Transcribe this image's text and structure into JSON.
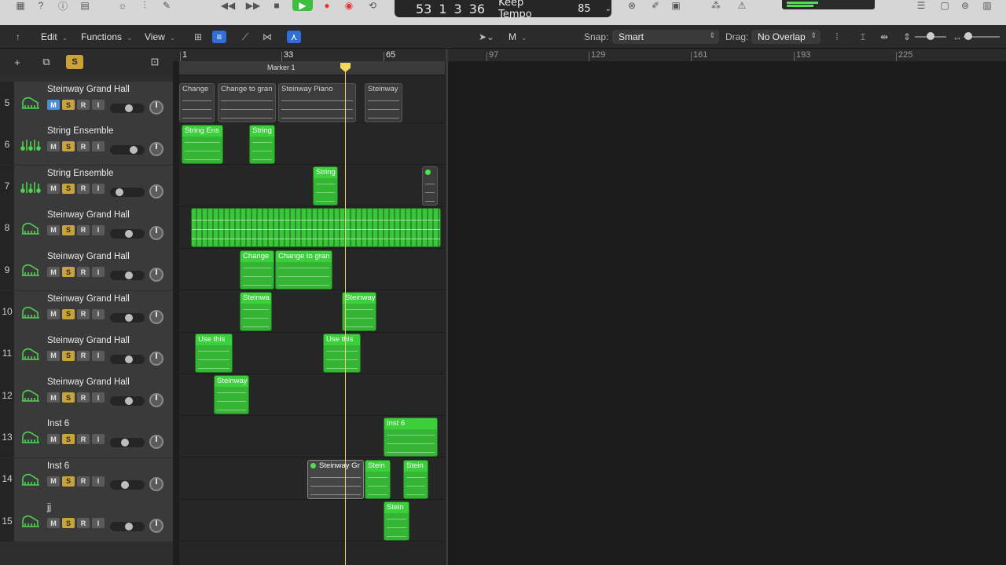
{
  "lcd": {
    "bar": "53",
    "beat": "1",
    "div": "3",
    "tick": "36",
    "tempo_mode": "Keep Tempo",
    "tempo": "85"
  },
  "toolbar": {
    "edit": "Edit",
    "functions": "Functions",
    "view": "View",
    "pointer_tool": "M",
    "snap_label": "Snap:",
    "snap_value": "Smart",
    "drag_label": "Drag:",
    "drag_value": "No Overlap"
  },
  "header": {
    "solo_label": "S"
  },
  "ruler": {
    "bars": [
      {
        "label": "1",
        "dim": false
      },
      {
        "label": "33",
        "dim": false
      },
      {
        "label": "65",
        "dim": false
      },
      {
        "label": "97",
        "dim": true
      },
      {
        "label": "129",
        "dim": true
      },
      {
        "label": "161",
        "dim": true
      },
      {
        "label": "193",
        "dim": true
      },
      {
        "label": "225",
        "dim": true
      }
    ],
    "marker": "Marker 1"
  },
  "colors": {
    "region_green": "#34b534",
    "solo": "#c9a23c",
    "mute_on": "#4a8fd4",
    "playhead": "#f0d95c"
  },
  "tracks": [
    {
      "num": "5",
      "name": "Steinway Grand Hall",
      "icon": "piano-icon",
      "mute_on": true,
      "vol": 0.55
    },
    {
      "num": "6",
      "name": "String Ensemble",
      "icon": "strings-icon",
      "mute_on": false,
      "vol": 0.75
    },
    {
      "num": "7",
      "name": "String Ensemble",
      "icon": "strings-icon",
      "mute_on": false,
      "vol": 0.2
    },
    {
      "num": "8",
      "name": "Steinway Grand Hall",
      "icon": "piano-icon",
      "mute_on": false,
      "vol": 0.55
    },
    {
      "num": "9",
      "name": "Steinway Grand Hall",
      "icon": "piano-icon",
      "mute_on": false,
      "vol": 0.55
    },
    {
      "num": "10",
      "name": "Steinway Grand Hall",
      "icon": "piano-icon",
      "mute_on": false,
      "vol": 0.55
    },
    {
      "num": "11",
      "name": "Steinway Grand Hall",
      "icon": "piano-icon",
      "mute_on": false,
      "vol": 0.55
    },
    {
      "num": "12",
      "name": "Steinway Grand Hall",
      "icon": "piano-icon",
      "mute_on": false,
      "vol": 0.55
    },
    {
      "num": "13",
      "name": "Inst 6",
      "icon": "piano-icon",
      "mute_on": false,
      "vol": 0.4
    },
    {
      "num": "14",
      "name": "Inst 6",
      "icon": "piano-icon",
      "mute_on": false,
      "vol": 0.4
    },
    {
      "num": "15",
      "name": "jj",
      "icon": "piano-icon",
      "mute_on": false,
      "vol": 0.55
    }
  ],
  "track_buttons": {
    "m": "M",
    "s": "S",
    "r": "R",
    "i": "I"
  },
  "regions": [
    {
      "name": "region-change-5",
      "title": "Change",
      "style": "gray"
    },
    {
      "name": "region-change-to-grand-5",
      "title": "Change to gran",
      "style": "gray"
    },
    {
      "name": "region-steinway-piano-5",
      "title": "Steinway Piano",
      "style": "gray"
    },
    {
      "name": "region-steinway-5",
      "title": "Steinway",
      "style": "gray"
    },
    {
      "name": "region-string-ens-6",
      "title": "String Ens",
      "style": "green"
    },
    {
      "name": "region-string-6",
      "title": "String",
      "style": "green"
    },
    {
      "name": "region-string-7",
      "title": "String",
      "style": "green"
    },
    {
      "name": "region-dot-7",
      "title": "",
      "style": "gray"
    },
    {
      "name": "region-change-9",
      "title": "Change",
      "style": "green"
    },
    {
      "name": "region-change-to-grand-9",
      "title": "Change to gran",
      "style": "green"
    },
    {
      "name": "region-steinwa-10",
      "title": "Steinwa",
      "style": "green"
    },
    {
      "name": "region-steinway-10",
      "title": "Steinway",
      "style": "green"
    },
    {
      "name": "region-use-this-11a",
      "title": "Use this",
      "style": "green"
    },
    {
      "name": "region-use-this-11b",
      "title": "Use this",
      "style": "green"
    },
    {
      "name": "region-steinway-12",
      "title": "Steinway",
      "style": "green"
    },
    {
      "name": "region-inst6-13",
      "title": "Inst 6",
      "style": "green"
    },
    {
      "name": "region-steinway-gr-14",
      "title": "Steinway Gr",
      "style": "selgray"
    },
    {
      "name": "region-stein-14a",
      "title": "Stein",
      "style": "green"
    },
    {
      "name": "region-stein-14b",
      "title": "Stein",
      "style": "green"
    },
    {
      "name": "region-stein-15",
      "title": "Stein",
      "style": "green"
    }
  ]
}
